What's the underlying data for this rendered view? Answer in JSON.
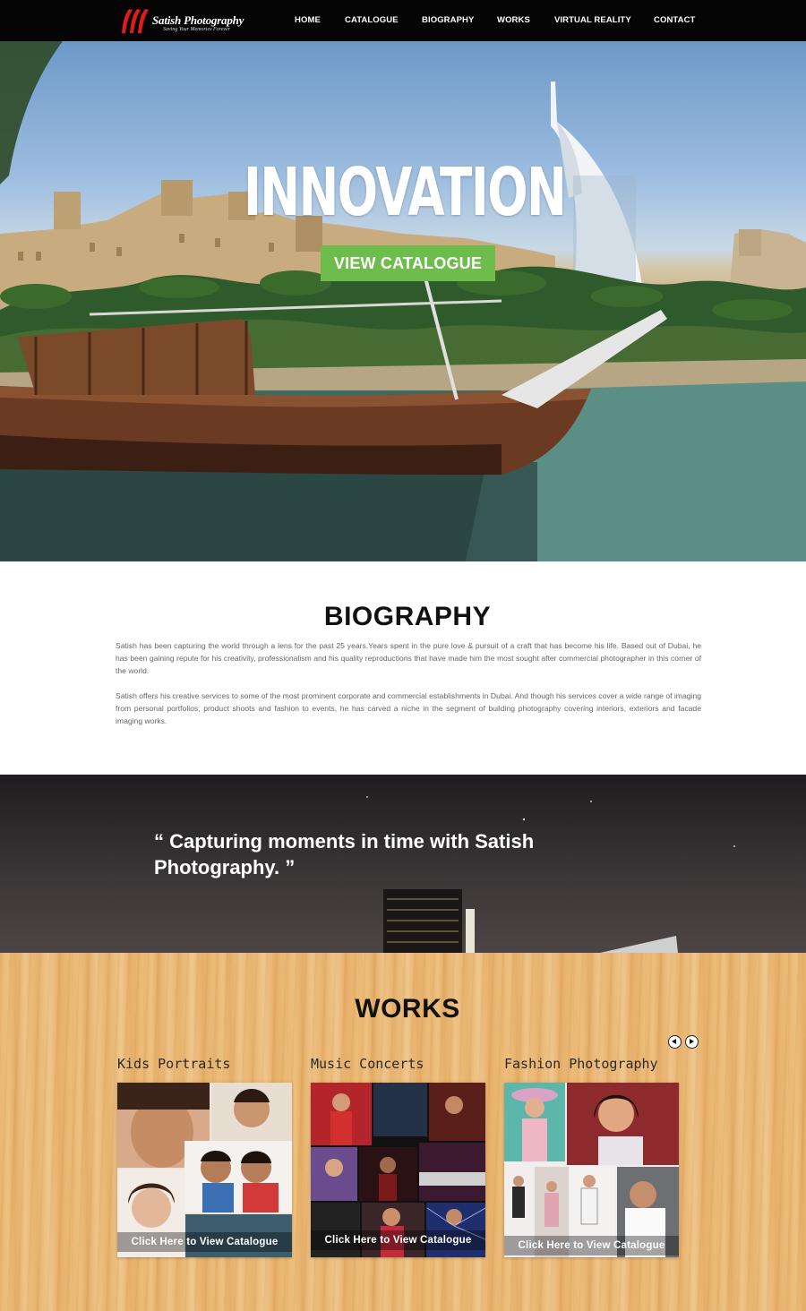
{
  "brand": {
    "name": "Satish Photography",
    "tagline": "Saving Your Memories Forever",
    "accent": "#e01b1b"
  },
  "nav": {
    "items": [
      "HOME",
      "CATALOGUE",
      "BIOGRAPHY",
      "WORKS",
      "VIRTUAL REALITY",
      "CONTACT"
    ]
  },
  "hero": {
    "title": "INNOVATION",
    "button": "VIEW CATALOGUE",
    "button_color": "#6ebc4b"
  },
  "biography": {
    "title": "BIOGRAPHY",
    "paragraphs": [
      "Satish has been capturing the world through a lens for the past 25 years.Years spent in the pure love & pursuit of a craft that has become his life. Based out of Dubai, he has been gaining repute for his creativity, professionalism and his quality reproductions that have made him the most sought after commercial photographer in this corner of the world.",
      "Satish offers his creative services to some of the most prominent corporate and commercial establishments in Dubai. And though his services cover a wide range of imaging from personal portfolios, product shoots and fashion to events, he has carved a niche in the segment of building photography covering interiors, exteriors and facade imaging works."
    ]
  },
  "quote": {
    "text": "“ Capturing moments in time with Satish Photography. ”"
  },
  "works": {
    "title": "WORKS",
    "prev_icon": "circle-arrow-left-icon",
    "next_icon": "circle-arrow-right-icon",
    "items": [
      {
        "label": "Kids Portraits",
        "cta": "Click Here to View Catalogue"
      },
      {
        "label": "Music Concerts",
        "cta": "Click Here to View Catalogue"
      },
      {
        "label": "Fashion Photography",
        "cta": "Click Here to View Catalogue"
      }
    ]
  }
}
